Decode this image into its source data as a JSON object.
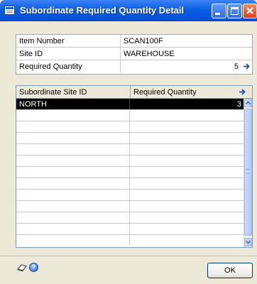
{
  "window": {
    "title": "Subordinate Required Quantity Detail"
  },
  "fields": {
    "item_number_label": "Item Number",
    "item_number_value": "SCAN100F",
    "site_id_label": "Site ID",
    "site_id_value": "WAREHOUSE",
    "required_quantity_label": "Required Quantity",
    "required_quantity_value": "5"
  },
  "grid": {
    "columns": [
      "Subordinate Site ID",
      "Required Quantity"
    ],
    "rows": [
      {
        "site": "NORTH",
        "qty": "3",
        "selected": true
      },
      {
        "site": "",
        "qty": ""
      },
      {
        "site": "",
        "qty": ""
      },
      {
        "site": "",
        "qty": ""
      },
      {
        "site": "",
        "qty": ""
      },
      {
        "site": "",
        "qty": ""
      },
      {
        "site": "",
        "qty": ""
      },
      {
        "site": "",
        "qty": ""
      },
      {
        "site": "",
        "qty": ""
      },
      {
        "site": "",
        "qty": ""
      },
      {
        "site": "",
        "qty": ""
      },
      {
        "site": "",
        "qty": ""
      },
      {
        "site": "",
        "qty": ""
      }
    ]
  },
  "footer": {
    "ok_label": "OK",
    "help_glyph": "?"
  },
  "icons": {
    "window": "window-icon",
    "minimize": "minimize-icon",
    "maximize": "maximize-icon",
    "close": "close-icon",
    "expand_arrow": "arrow-right-icon",
    "eraser": "eraser-icon",
    "help": "help-icon"
  },
  "colors": {
    "titlebar": "#0a5fe6",
    "selected_row": "#000000",
    "arrow": "#1d4fbf"
  }
}
